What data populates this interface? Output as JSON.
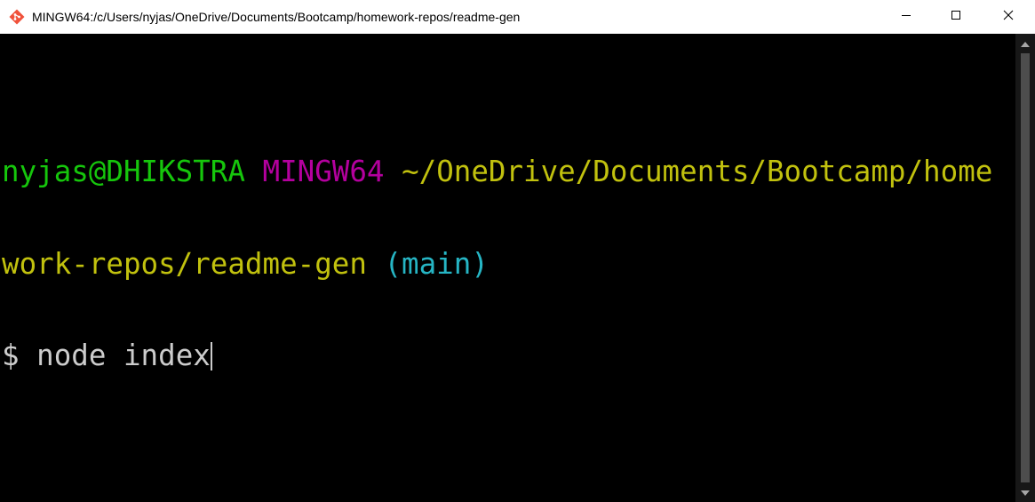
{
  "window": {
    "title": "MINGW64:/c/Users/nyjas/OneDrive/Documents/Bootcamp/homework-repos/readme-gen",
    "icon": "git-bash-icon",
    "controls": {
      "minimize_icon": "minimize-icon",
      "maximize_icon": "maximize-icon",
      "close_icon": "close-icon"
    }
  },
  "terminal": {
    "prompt": {
      "user_host": "nyjas@DHIKSTRA",
      "env": "MINGW64",
      "path_line1": "~/OneDrive/Documents/Bootcamp/home",
      "path_line2": "work-repos/readme-gen",
      "branch": "(main)",
      "symbol": "$"
    },
    "command": "node index"
  },
  "colors": {
    "background": "#000000",
    "user_host": "#16c60c",
    "env": "#b4009e",
    "path": "#c1c10e",
    "branch": "#26b5c4",
    "text": "#cccccc"
  }
}
